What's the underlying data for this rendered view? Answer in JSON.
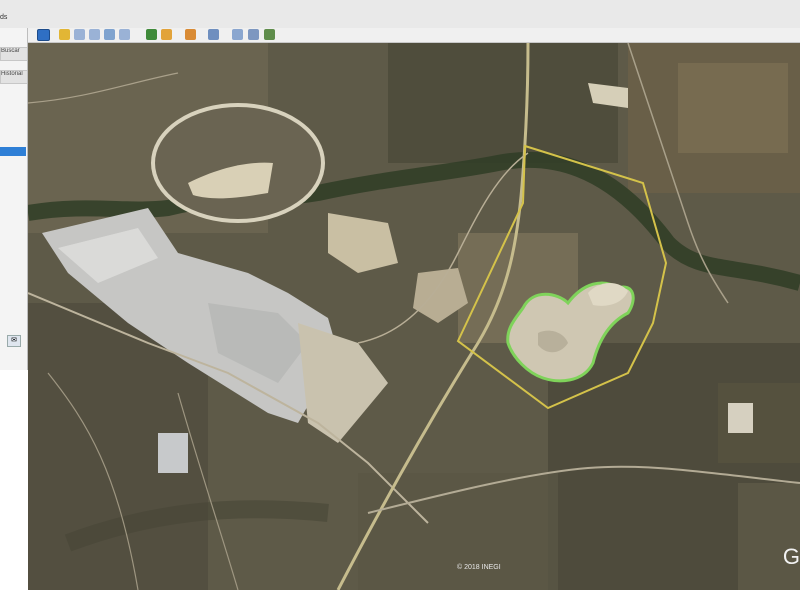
{
  "window": {
    "title_fragment": "ds"
  },
  "sidebar": {
    "buttons": [
      "Buscar",
      "Historial"
    ],
    "icon": "email-icon"
  },
  "toolbar": {
    "buttons": [
      {
        "name": "hide-sidebar-icon",
        "active": true
      },
      {
        "name": "add-placemark-icon"
      },
      {
        "name": "add-polygon-icon"
      },
      {
        "name": "add-path-icon"
      },
      {
        "name": "add-image-overlay-icon"
      },
      {
        "name": "record-tour-icon"
      },
      {
        "name": "historical-imagery-icon"
      },
      {
        "name": "sunlight-icon"
      },
      {
        "name": "planets-icon"
      },
      {
        "name": "ruler-icon"
      },
      {
        "name": "email-icon"
      },
      {
        "name": "print-icon"
      },
      {
        "name": "view-in-maps-icon"
      }
    ]
  },
  "map": {
    "copyright": "© 2018 INEGI",
    "logo": "G",
    "colors": {
      "boundary": "#d4c24a",
      "mine_outline": "#7fd35a",
      "terrain": "#5d5947"
    }
  }
}
